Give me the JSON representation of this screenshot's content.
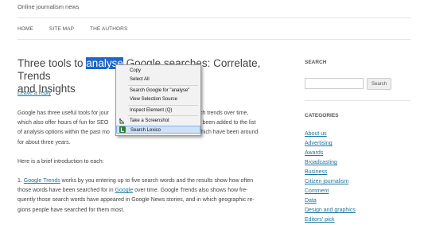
{
  "site": {
    "description": "Online journalism news"
  },
  "nav": {
    "items": [
      "HOME",
      "SITE MAP",
      "THE AUTHORS"
    ]
  },
  "post": {
    "title_before": "Three tools to ",
    "title_highlight": "analyse",
    "title_partial": " Google searches: Correlate, Trends",
    "title_line2": "and Insights",
    "reply": "Leave a reply",
    "p1_a": "Google has three useful tools for jour",
    "p1_a_end": "earch trends over time,",
    "p1_b": "which also offer hours of fun for SEO",
    "p1_b_end": "as been added to the list",
    "p1_c": "of analysis options within the past mo",
    "p1_c_end": "which have been around",
    "p1_d": "for about three years.",
    "p2": "Here is a brief introduction to each:",
    "p3_num": "1. ",
    "p3_link1": "Google Trends",
    "p3_a": " works by you entering up to five search words and the results show how often",
    "p3_b_pre": "those words have been searched for in ",
    "p3_link2": "Google",
    "p3_b_post": " over time. Google Trends also shows how fre-",
    "p3_c": "quently those search words have appeared in Google News stories, and in which geographic re-",
    "p3_d": "gions people have searched for them most."
  },
  "context_menu": {
    "items": [
      {
        "label": "Copy",
        "icon": ""
      },
      {
        "label": "Select All",
        "icon": ""
      },
      {
        "label": "Search Google for \"analyse\"",
        "icon": ""
      },
      {
        "label": "View Selection Source",
        "icon": ""
      },
      {
        "label": "Inspect Element (Q)",
        "icon": ""
      },
      {
        "label": "Take a Screenshot",
        "icon": "screenshot-icon"
      },
      {
        "label": "Search Lexico",
        "icon": "lexico-icon"
      }
    ]
  },
  "sidebar": {
    "search_heading": "SEARCH",
    "search_button": "Search",
    "categories_heading": "CATEGORIES",
    "categories": [
      "About us",
      "Advertising",
      "Awards",
      "Broadcasting",
      "Business",
      "Citizen journalism",
      "Comment",
      "Data",
      "Design and graphics",
      "Editors' pick"
    ]
  }
}
